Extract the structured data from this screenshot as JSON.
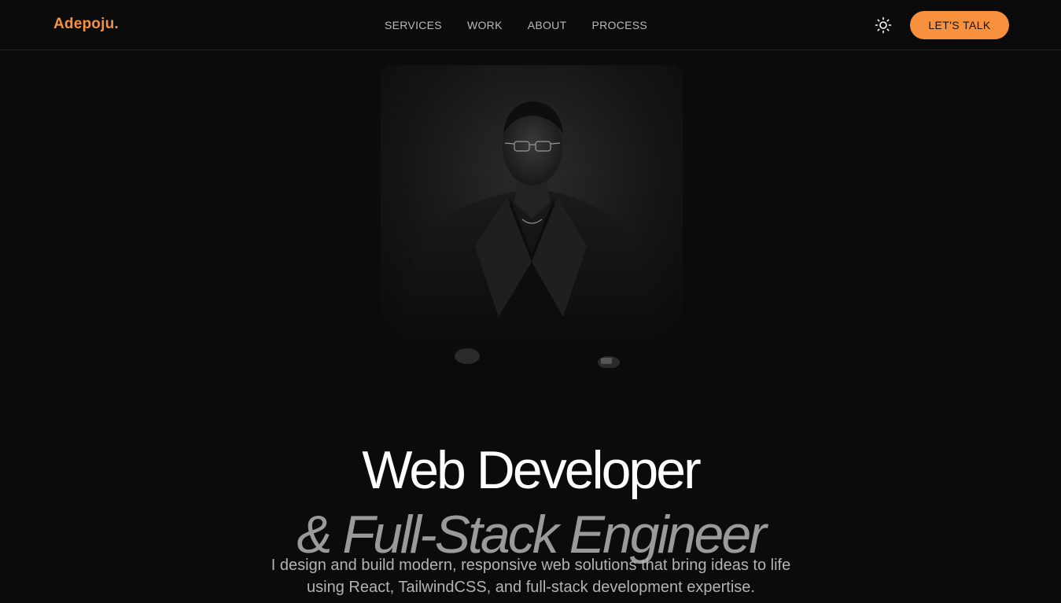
{
  "header": {
    "logo": "Adepoju.",
    "nav": [
      {
        "label": "SERVICES"
      },
      {
        "label": "WORK"
      },
      {
        "label": "ABOUT"
      },
      {
        "label": "PROCESS"
      }
    ],
    "theme_toggle_icon": "sun-icon",
    "cta_label": "LET'S TALK"
  },
  "hero": {
    "portrait_alt": "portrait-photo",
    "title": "Web Developer",
    "subtitle": "& Full-Stack Engineer",
    "description": "I design and build modern, responsive web solutions that bring ideas to life using React, TailwindCSS, and full-stack development expertise."
  },
  "colors": {
    "accent": "#f7913d",
    "background": "#0b0b0b",
    "text_primary": "#ffffff",
    "text_muted": "#9a9a9a"
  }
}
